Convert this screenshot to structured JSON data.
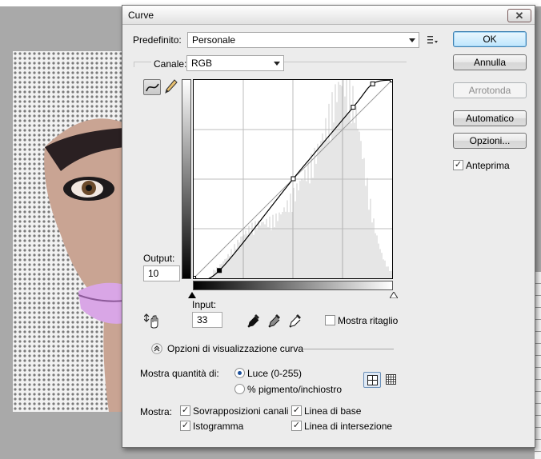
{
  "dialog": {
    "title": "Curve",
    "close_glyph": "✕"
  },
  "preset": {
    "label": "Predefinito:",
    "value": "Personale"
  },
  "channel": {
    "label": "Canale:",
    "value": "RGB"
  },
  "buttons": {
    "ok": "OK",
    "cancel": "Annulla",
    "smooth": "Arrotonda",
    "auto": "Automatico",
    "options": "Opzioni..."
  },
  "preview": {
    "label": "Anteprima",
    "checked": true
  },
  "output": {
    "label": "Output:",
    "value": "10"
  },
  "input": {
    "label": "Input:",
    "value": "33"
  },
  "show_clipping": {
    "label": "Mostra ritaglio",
    "checked": false
  },
  "display_options": {
    "header": "Opzioni di visualizzazione curva",
    "show_amount_label": "Mostra quantità di:",
    "light_label": "Luce (0-255)",
    "light_selected": true,
    "pigment_label": "% pigmento/inchiostro",
    "show_label": "Mostra:",
    "channel_overlays": "Sovrapposizioni canali",
    "histogram": "Istogramma",
    "baseline": "Linea di base",
    "intersection_line": "Linea di intersezione"
  },
  "curve_points": [
    [
      0,
      0
    ],
    [
      33,
      10
    ],
    [
      128,
      128
    ],
    [
      205,
      220
    ],
    [
      230,
      250
    ],
    [
      255,
      255
    ]
  ],
  "icons": {
    "curve_tool": "curve-tool-icon",
    "pencil_tool": "pencil-icon",
    "preset_menu": "preset-options-icon",
    "hand_adjust": "on-image-adjust-icon",
    "black_eyedropper": "black-point-eyedropper-icon",
    "gray_eyedropper": "gray-point-eyedropper-icon",
    "white_eyedropper": "white-point-eyedropper-icon",
    "expand": "collapse-chevron-icon",
    "grid_simple": "simple-grid-icon",
    "grid_detailed": "detailed-grid-icon"
  }
}
